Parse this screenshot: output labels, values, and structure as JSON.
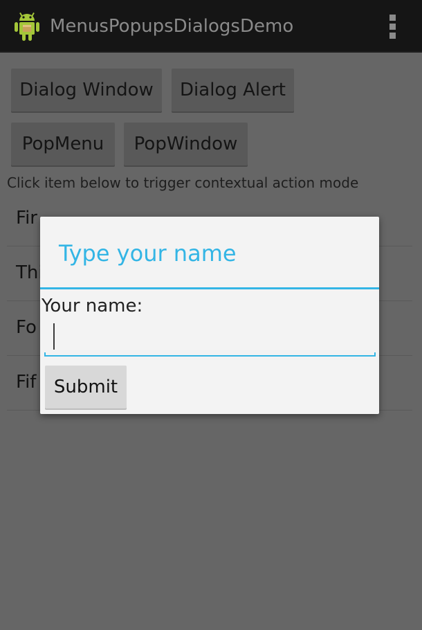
{
  "action_bar": {
    "title": "MenusPopupsDialogsDemo",
    "app_icon": "android-icon",
    "overflow_icon": "overflow-menu-icon"
  },
  "buttons": {
    "dialog_window": "Dialog Window",
    "dialog_alert": "Dialog Alert",
    "pop_menu": "PopMenu",
    "pop_window": "PopWindow"
  },
  "hint": "Click item below to trigger contextual action mode",
  "list": {
    "items": [
      {
        "label": "Fir"
      },
      {
        "label": "Thi"
      },
      {
        "label": "Fo"
      },
      {
        "label": "Fif"
      }
    ]
  },
  "dialog": {
    "title": "Type your name",
    "field_label": "Your name:",
    "input_value": "",
    "submit_label": "Submit"
  },
  "colors": {
    "accent": "#33b5e5",
    "action_bar": "#151515",
    "dim_background": "#666666",
    "dialog_background": "#f3f3f3"
  }
}
